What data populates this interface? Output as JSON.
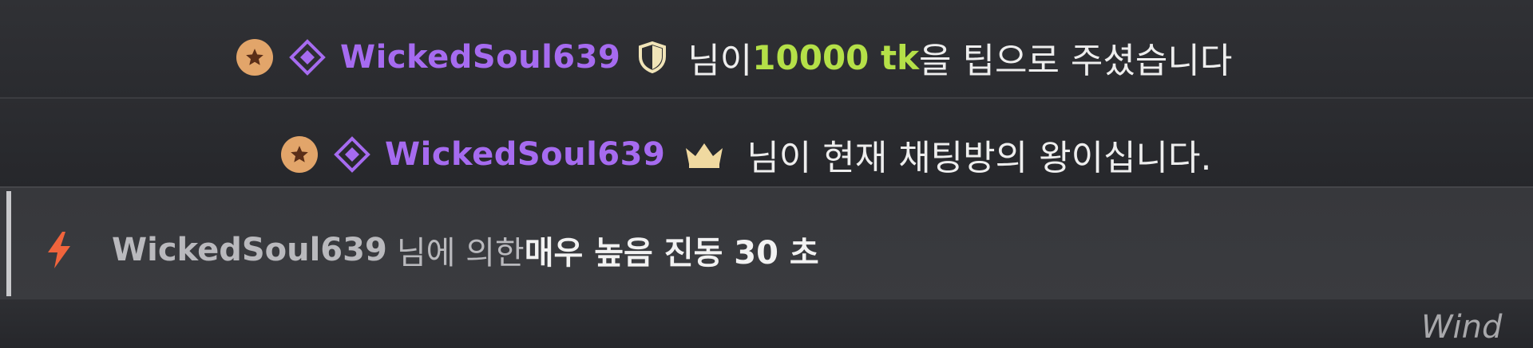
{
  "messages": [
    {
      "username": "WickedSoul639",
      "pre": "님이 ",
      "amount": "10000 tk",
      "post": "을 팁으로 주셨습니다"
    },
    {
      "username": "WickedSoul639",
      "text": "님이 현재 채팅방의 왕이십니다."
    },
    {
      "username": "WickedSoul639",
      "pre": "님에 의한 ",
      "emphasis": "매우 높음 진동 30 초"
    }
  ],
  "watermark": "Wind",
  "colors": {
    "username": "#a66bf0",
    "amount": "#b4e048",
    "star_badge": "#e2a56a",
    "crown": "#f0d9a0",
    "bolt": "#f0643c"
  },
  "icons": [
    "star-badge-icon",
    "diamond-icon",
    "shield-icon",
    "crown-icon",
    "lightning-icon"
  ]
}
